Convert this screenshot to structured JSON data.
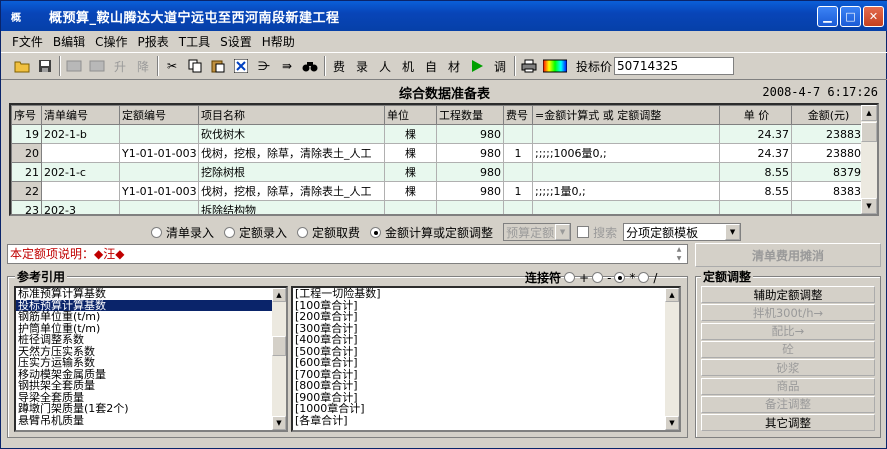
{
  "window": {
    "title": "概预算_鞍山腾达大道宁远屯至西河南段新建工程",
    "icon_label": "概"
  },
  "menu": [
    "F文件",
    "B编辑",
    "C操作",
    "P报表",
    "T工具",
    "S设置",
    "H帮助"
  ],
  "toolbar": {
    "buttons": [
      "open-folder-icon",
      "save-icon",
      "disabled-a-icon",
      "disabled-b-icon",
      "升",
      "降",
      "cut-icon",
      "copy-icon",
      "paste-icon",
      "delete-icon",
      "insert-icon",
      "append-icon",
      "find-icon",
      "费",
      "录",
      "人",
      "机",
      "自",
      "材",
      "play-icon",
      "调",
      "print-icon",
      "color-icon"
    ],
    "bid_label": "投标价",
    "bid_value": "50714325"
  },
  "header": {
    "title": "综合数据准备表",
    "datetime": "2008-4-7  6:17:26"
  },
  "grid": {
    "columns": [
      "序号",
      "清单编号",
      "定额编号",
      "项目名称",
      "单位",
      "工程数量",
      "费号",
      "=金额计算式 或 定额调整",
      "单  价",
      "金额(元)"
    ],
    "rows": [
      {
        "no": "19",
        "code": "202-1-b",
        "quota": "",
        "name": "砍伐树木",
        "unit": "棵",
        "qty": "980",
        "fee": "",
        "formula": "",
        "price": "24.37",
        "amount": "23883",
        "green": true
      },
      {
        "no": "20",
        "code": "",
        "quota": "Y1-01-01-003",
        "name": "伐树，挖根，除草，清除表土_人工",
        "unit": "棵",
        "qty": "980",
        "fee": "1",
        "formula": ";;;;;1006量0,;",
        "price": "24.37",
        "amount": "23880",
        "green": false
      },
      {
        "no": "21",
        "code": "202-1-c",
        "quota": "",
        "name": "挖除树根",
        "unit": "棵",
        "qty": "980",
        "fee": "",
        "formula": "",
        "price": "8.55",
        "amount": "8379",
        "green": true
      },
      {
        "no": "22",
        "code": "",
        "quota": "Y1-01-01-003",
        "name": "伐树，挖根，除草，清除表土_人工",
        "unit": "棵",
        "qty": "980",
        "fee": "1",
        "formula": ";;;;;1量0,;",
        "price": "8.55",
        "amount": "8383",
        "green": false
      },
      {
        "no": "23",
        "code": "202-3",
        "quota": "",
        "name": "拆除结构物",
        "unit": "",
        "qty": "",
        "fee": "",
        "formula": "",
        "price": "",
        "amount": "",
        "green": true
      }
    ]
  },
  "modes": {
    "options": [
      "清单录入",
      "定额录入",
      "定额取费",
      "金额计算或定额调整"
    ],
    "selected": 3,
    "calc_combo": "预算定额",
    "search_label": "搜索",
    "template_combo": "分项定额模板"
  },
  "description": "本定额项说明：◆汪◆",
  "alloc_button": "清单费用摊消",
  "reference": {
    "title": "参考引用",
    "connector_label": "连接符",
    "connector_options": [
      "+",
      "-",
      "*",
      "/"
    ],
    "connector_selected": 2,
    "left_items": [
      "标准预算计算基数",
      "投标预算计算基数",
      "钢筋单位重(t/m)",
      "护筒单位重(t/m)",
      "桩径调整系数",
      "天然方压实系数",
      "压实方运输系数",
      "移动模架金属质量",
      "钢拱架全套质量",
      "导梁全套质量",
      "蹲墩门架质量(1套2个)",
      "悬臂吊机质量"
    ],
    "left_selected": 1,
    "right_items": [
      "[工程一切险基数]",
      "[100章合计]",
      "[200章合计]",
      "[300章合计]",
      "[400章合计]",
      "[500章合计]",
      "[600章合计]",
      "[700章合计]",
      "[800章合计]",
      "[900章合计]",
      "[1000章合计]",
      "[各章合计]"
    ]
  },
  "adjust": {
    "title": "定额调整",
    "buttons": [
      {
        "label": "辅助定额调整",
        "enabled": true
      },
      {
        "label": "拌机300t/h→",
        "enabled": false
      },
      {
        "label": "配比→",
        "enabled": false
      },
      {
        "label": "砼",
        "enabled": false
      },
      {
        "label": "砂浆",
        "enabled": false
      },
      {
        "label": "商品",
        "enabled": false
      },
      {
        "label": "备注调整",
        "enabled": false
      },
      {
        "label": "其它调整",
        "enabled": true
      }
    ]
  }
}
